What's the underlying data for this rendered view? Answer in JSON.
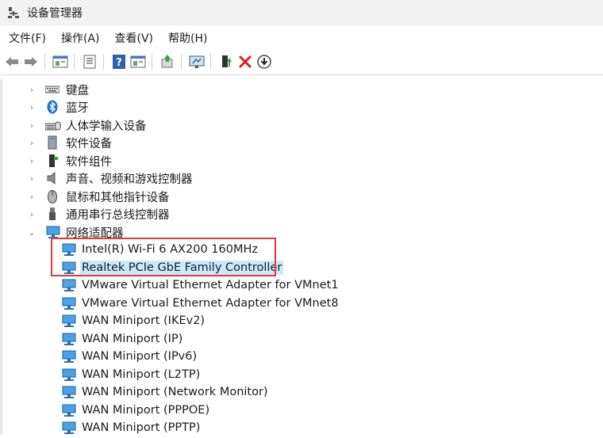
{
  "window": {
    "title": "设备管理器"
  },
  "menu": [
    "文件(F)",
    "操作(A)",
    "查看(V)",
    "帮助(H)"
  ],
  "toolbar": {
    "buttons": [
      "back-icon",
      "forward-icon",
      "properties-icon",
      "help-topics-icon",
      "help-icon",
      "view-icon",
      "update-driver-icon",
      "scan-hardware-icon",
      "enable-device-icon",
      "uninstall-icon",
      "download-icon"
    ]
  },
  "tree": {
    "categories": [
      {
        "label": "键盘",
        "icon": "keyboard-icon",
        "expanded": false
      },
      {
        "label": "蓝牙",
        "icon": "bluetooth-icon",
        "expanded": false
      },
      {
        "label": "人体学输入设备",
        "icon": "hid-icon",
        "expanded": false
      },
      {
        "label": "软件设备",
        "icon": "software-device-icon",
        "expanded": false
      },
      {
        "label": "软件组件",
        "icon": "software-component-icon",
        "expanded": false
      },
      {
        "label": "声音、视频和游戏控制器",
        "icon": "speaker-icon",
        "expanded": false
      },
      {
        "label": "鼠标和其他指针设备",
        "icon": "mouse-icon",
        "expanded": false
      },
      {
        "label": "通用串行总线控制器",
        "icon": "usb-icon",
        "expanded": false
      },
      {
        "label": "网络适配器",
        "icon": "network-adapter-icon",
        "expanded": true
      }
    ],
    "adapters": [
      "Intel(R) Wi-Fi 6 AX200 160MHz",
      "Realtek PCIe GbE Family Controller",
      "VMware Virtual Ethernet Adapter for VMnet1",
      "VMware Virtual Ethernet Adapter for VMnet8",
      "WAN Miniport (IKEv2)",
      "WAN Miniport (IP)",
      "WAN Miniport (IPv6)",
      "WAN Miniport (L2TP)",
      "WAN Miniport (Network Monitor)",
      "WAN Miniport (PPPOE)",
      "WAN Miniport (PPTP)"
    ],
    "selected_adapter": "Realtek PCIe GbE Family Controller"
  },
  "colors": {
    "selection": "#cce8ff",
    "highlight_border": "#e03a3a",
    "uninstall": "#d62020"
  }
}
